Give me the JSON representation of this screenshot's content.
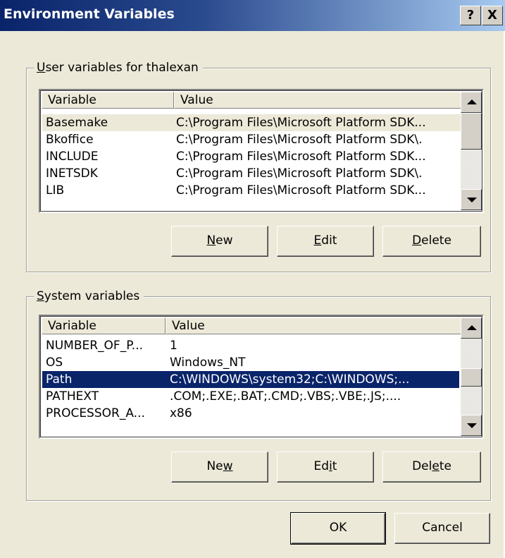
{
  "window": {
    "title": "Environment Variables",
    "help_label": "?",
    "close_label": "X"
  },
  "user_group": {
    "label_prefix": "",
    "label_access": "U",
    "label_rest": "ser variables for thalexan",
    "columns": [
      "Variable",
      "Value"
    ],
    "rows": [
      {
        "name": "Basemake",
        "value": "C:\\Program Files\\Microsoft Platform SDK..."
      },
      {
        "name": "Bkoffice",
        "value": "C:\\Program Files\\Microsoft Platform SDK\\."
      },
      {
        "name": "INCLUDE",
        "value": "C:\\Program Files\\Microsoft Platform SDK..."
      },
      {
        "name": "INETSDK",
        "value": "C:\\Program Files\\Microsoft Platform SDK\\."
      },
      {
        "name": "LIB",
        "value": "C:\\Program Files\\Microsoft Platform SDK..."
      }
    ],
    "buttons": {
      "new": {
        "pre": "",
        "key": "N",
        "post": "ew"
      },
      "edit": {
        "pre": "",
        "key": "E",
        "post": "dit"
      },
      "delete": {
        "pre": "",
        "key": "D",
        "post": "elete"
      }
    }
  },
  "system_group": {
    "label_access": "S",
    "label_rest": "ystem variables",
    "columns": [
      "Variable",
      "Value"
    ],
    "rows": [
      {
        "name": "NUMBER_OF_P...",
        "value": "1"
      },
      {
        "name": "OS",
        "value": "Windows_NT"
      },
      {
        "name": "Path",
        "value": "C:\\WINDOWS\\system32;C:\\WINDOWS;..."
      },
      {
        "name": "PATHEXT",
        "value": ".COM;.EXE;.BAT;.CMD;.VBS;.VBE;.JS;...."
      },
      {
        "name": "PROCESSOR_A...",
        "value": "x86"
      }
    ],
    "buttons": {
      "new": {
        "pre": "Ne",
        "key": "w",
        "post": ""
      },
      "edit": {
        "pre": "Ed",
        "key": "i",
        "post": "t"
      },
      "delete": {
        "pre": "Del",
        "key": "e",
        "post": "te"
      }
    }
  },
  "footer": {
    "ok_label": "OK",
    "cancel_label": "Cancel"
  },
  "colors": {
    "title_gradient_start": "#0a246a",
    "title_gradient_end": "#a6caf0",
    "selection": "#0a246a",
    "dialog_bg": "#ece9d8"
  }
}
